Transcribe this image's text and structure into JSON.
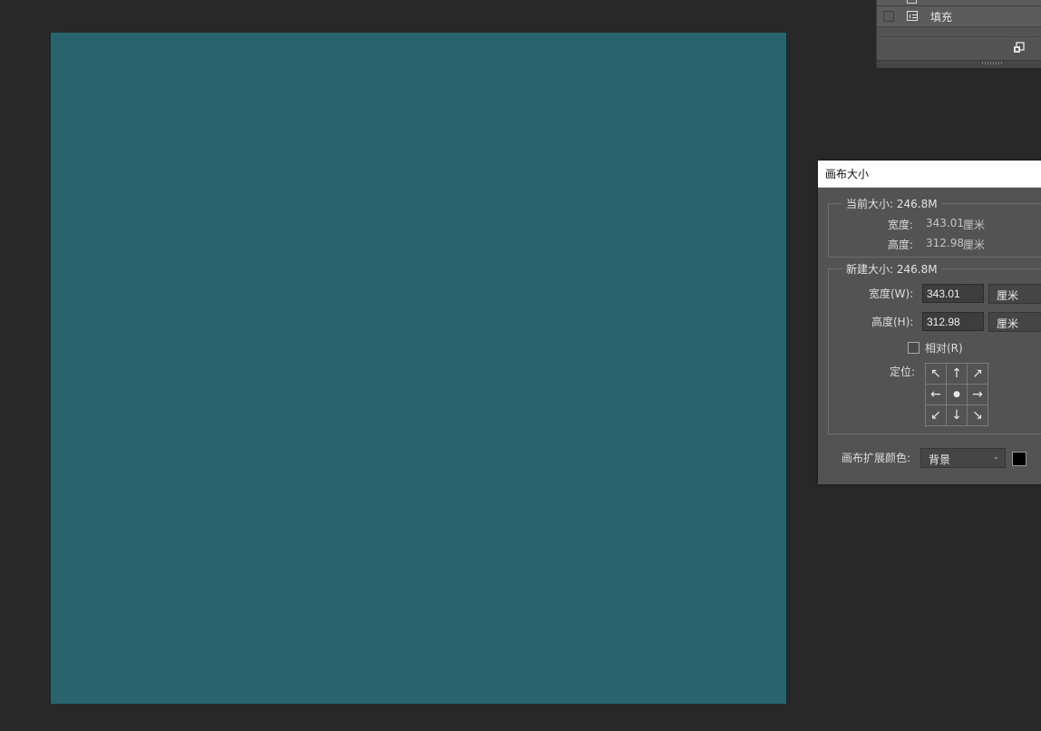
{
  "canvas": {
    "color": "#29646e"
  },
  "layers_panel": {
    "fill_layer_label": "填充"
  },
  "dialog": {
    "title": "画布大小",
    "current_size": {
      "legend": "当前大小: 246.8M",
      "width_label": "宽度:",
      "width_value": "343.01",
      "width_unit": "厘米",
      "height_label": "高度:",
      "height_value": "312.98",
      "height_unit": "厘米"
    },
    "new_size": {
      "legend": "新建大小: 246.8M",
      "width_label": "宽度(W):",
      "width_value": "343.01",
      "width_unit": "厘米",
      "height_label": "高度(H):",
      "height_value": "312.98",
      "height_unit": "厘米",
      "relative_label": "相对(R)",
      "relative_checked": false,
      "anchor_label": "定位:",
      "anchor_icons": [
        "arrow-up-left-icon",
        "arrow-up-icon",
        "arrow-up-right-icon",
        "arrow-left-icon",
        "anchor-center-icon",
        "arrow-right-icon",
        "arrow-down-left-icon",
        "arrow-down-icon",
        "arrow-down-right-icon"
      ],
      "anchor_glyphs": [
        "↖",
        "↑",
        "↗",
        "←",
        "●",
        "→",
        "↙",
        "↓",
        "↘"
      ]
    },
    "extension_color": {
      "label": "画布扩展颜色:",
      "value": "背景",
      "swatch_color": "#000000"
    }
  }
}
